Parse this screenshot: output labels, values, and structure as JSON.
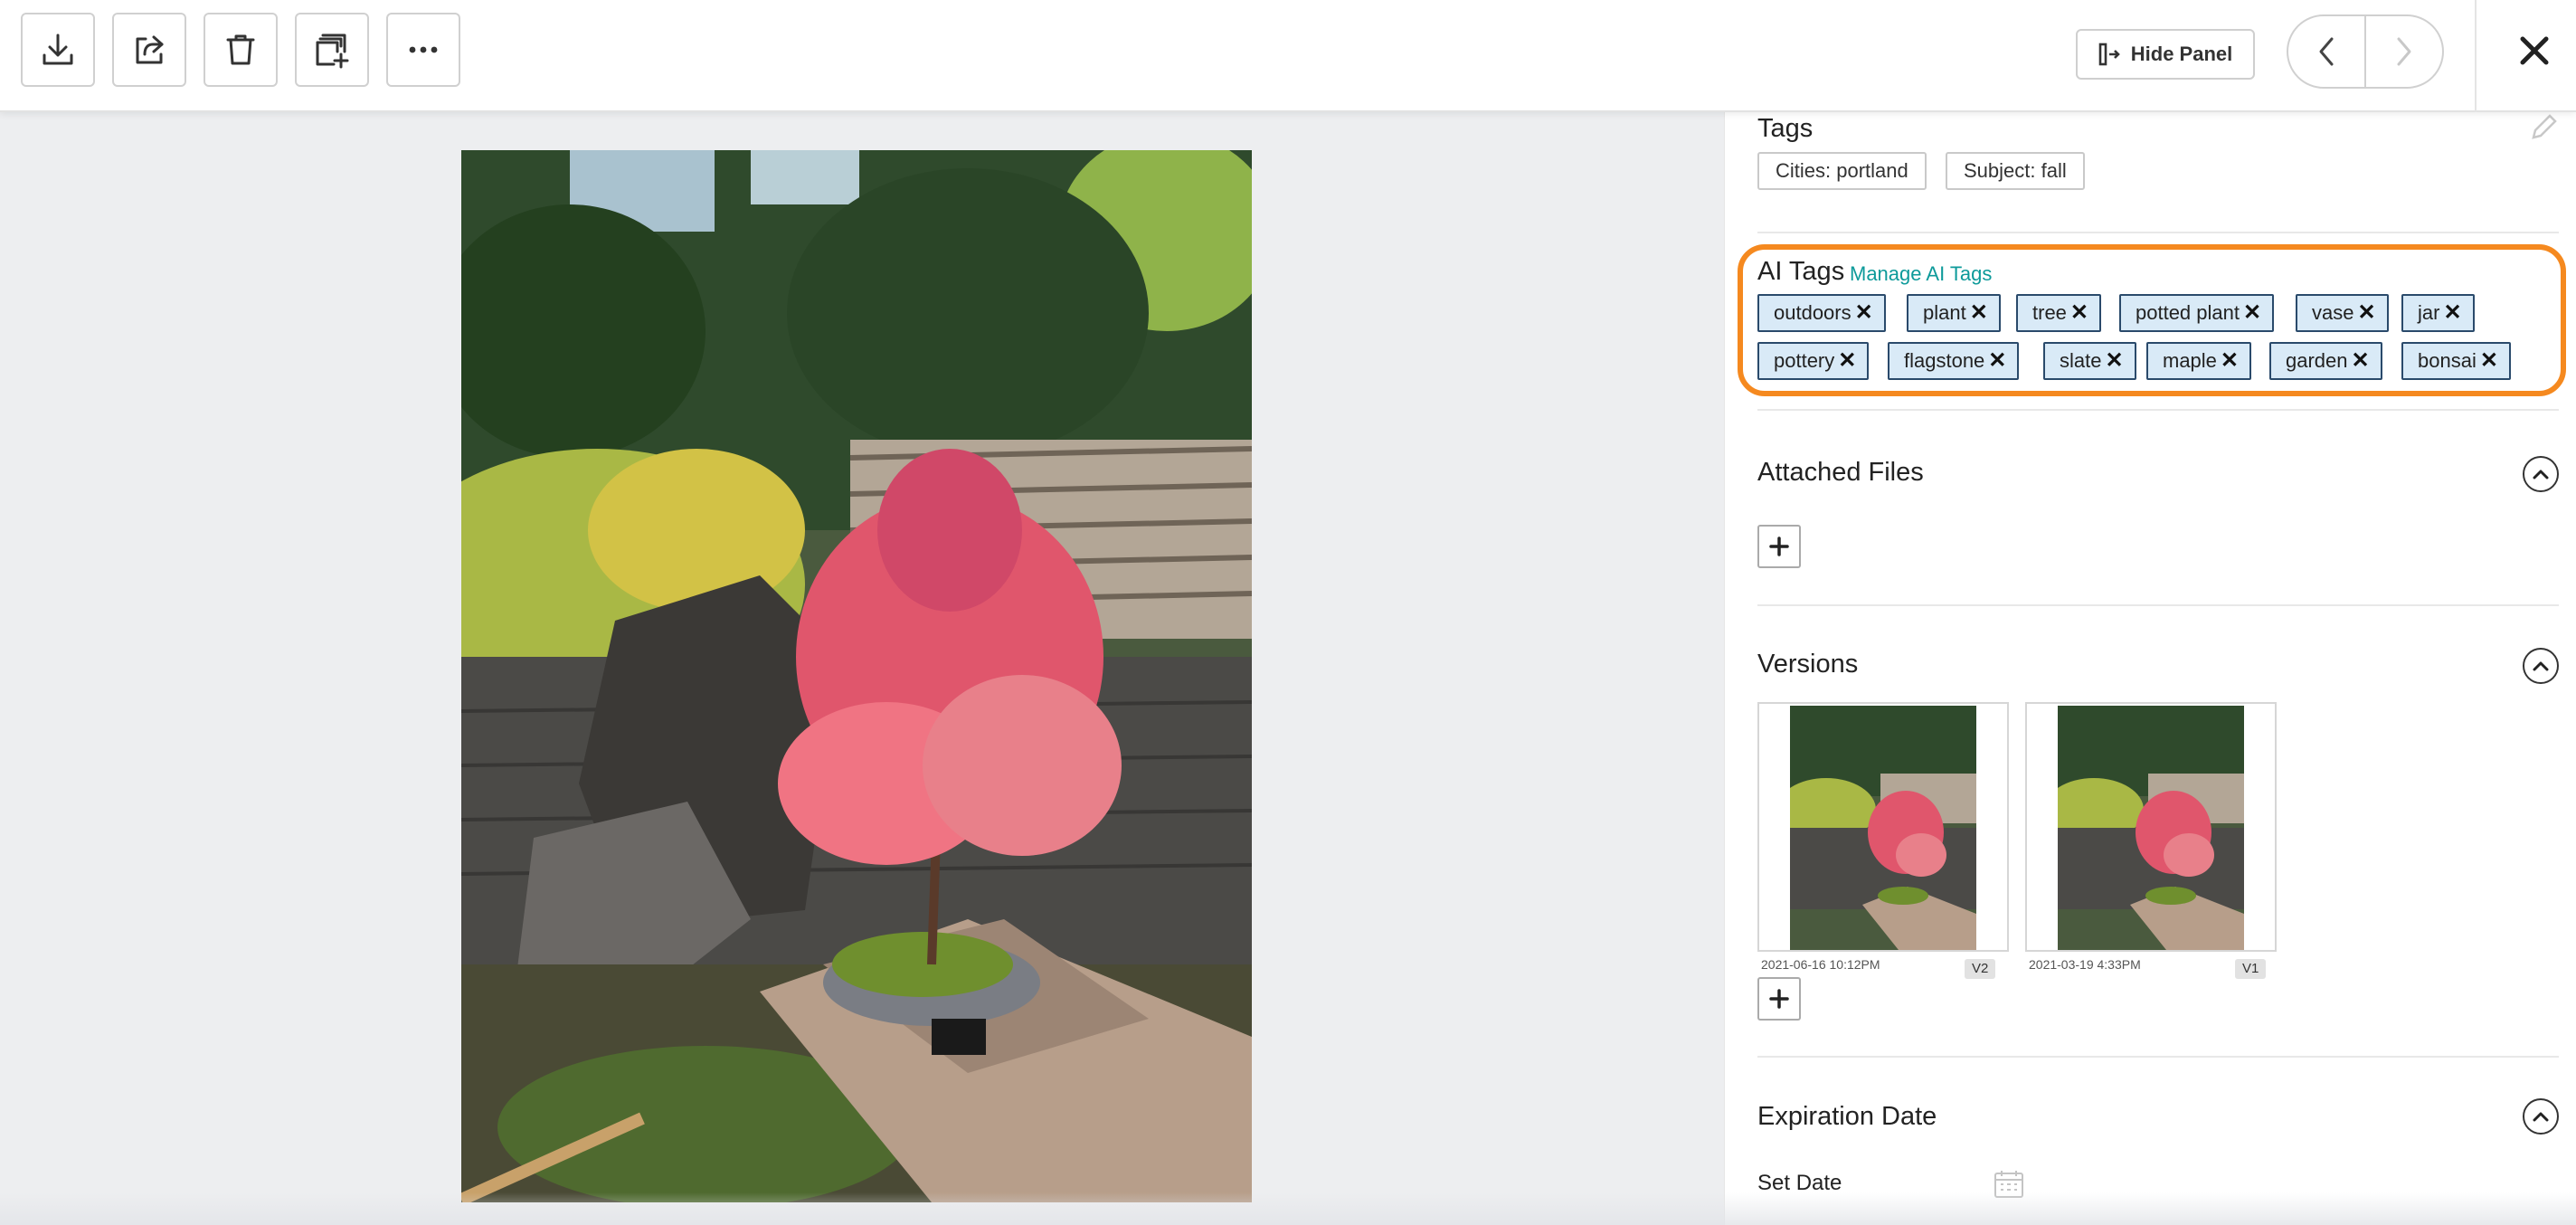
{
  "toolbar": {
    "buttons": [
      {
        "icon": "download-icon"
      },
      {
        "icon": "share-icon"
      },
      {
        "icon": "trash-icon"
      },
      {
        "icon": "add-to-collection-icon"
      },
      {
        "icon": "more-icon"
      }
    ],
    "hide_panel_label": "Hide Panel",
    "nav_prev_icon": "chevron-left-icon",
    "nav_next_icon": "chevron-right-icon",
    "close_icon": "close-icon"
  },
  "panel": {
    "tags": {
      "title": "Tags",
      "items": [
        "Cities: portland",
        "Subject: fall"
      ]
    },
    "ai_tags": {
      "title": "AI Tags",
      "manage_link": "Manage AI Tags",
      "highlight_color": "#f5891f",
      "row1": [
        "outdoors",
        "plant",
        "tree",
        "potted plant",
        "vase",
        "jar"
      ],
      "row2": [
        "pottery",
        "flagstone",
        "slate",
        "maple",
        "garden",
        "bonsai"
      ],
      "remove_glyph": "✕"
    },
    "attached_files": {
      "title": "Attached Files"
    },
    "versions": {
      "title": "Versions",
      "items": [
        {
          "date": "2021-06-16 10:12PM",
          "badge": "V2"
        },
        {
          "date": "2021-03-19 4:33PM",
          "badge": "V1"
        }
      ]
    },
    "expiration": {
      "title": "Expiration Date",
      "set_date_label": "Set Date"
    }
  },
  "colors": {
    "accent_link": "#0d9a9a",
    "ai_tag_bg": "#d9eaf7",
    "ai_tag_border": "#2a4a6b"
  }
}
